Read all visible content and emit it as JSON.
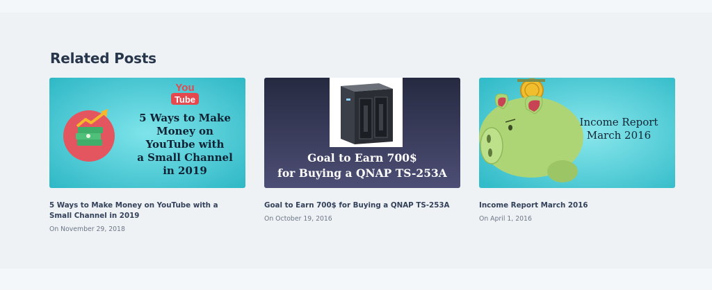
{
  "section": {
    "title": "Related Posts"
  },
  "posts": [
    {
      "title": "5 Ways to Make Money on YouTube with a Small Channel in 2019",
      "date": "On November 29, 2018",
      "thumbnail": {
        "badge_line1": "You",
        "badge_line2": "Tube",
        "text_lines": [
          "5 Ways to Make",
          "Money on",
          "YouTube with",
          "a Small Channel",
          "in 2019"
        ],
        "icon": "money-growth-icon",
        "colors": {
          "bg": "#37c3d0",
          "circle": "#e3555f",
          "badge": "#e5484d"
        }
      }
    },
    {
      "title": "Goal to Earn 700$ for Buying a QNAP TS-253A",
      "date": "On October 19, 2016",
      "thumbnail": {
        "text_lines": [
          "Goal to Earn 700$",
          "for Buying a QNAP TS-253A"
        ],
        "icon": "nas-device-icon",
        "colors": {
          "bg_top": "#2b2f46",
          "bg_bottom": "#4a4b70"
        }
      }
    },
    {
      "title": "Income Report March 2016",
      "date": "On April 1, 2016",
      "thumbnail": {
        "text_lines": [
          "Income Report",
          "March 2016"
        ],
        "icon": "piggy-bank-icon",
        "colors": {
          "bg": "#3cc4cf",
          "pig": "#aed575",
          "coin": "#f1bf2e"
        }
      }
    }
  ]
}
